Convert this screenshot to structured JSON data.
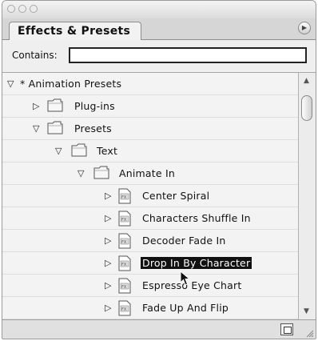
{
  "panel": {
    "tab_label": "Effects & Presets",
    "contains_label": "Contains:",
    "contains_value": ""
  },
  "tree": [
    {
      "label": "* Animation Presets",
      "type": "root",
      "expanded": true
    },
    {
      "label": "Plug-ins",
      "type": "folder",
      "expanded": false
    },
    {
      "label": "Presets",
      "type": "folder",
      "expanded": true
    },
    {
      "label": "Text",
      "type": "folder",
      "expanded": true
    },
    {
      "label": "Animate In",
      "type": "folder",
      "expanded": true
    },
    {
      "label": "Center Spiral",
      "type": "preset"
    },
    {
      "label": "Characters Shuffle In",
      "type": "preset"
    },
    {
      "label": "Decoder Fade In",
      "type": "preset"
    },
    {
      "label": "Drop In By Character",
      "type": "preset",
      "selected": true
    },
    {
      "label": "Espresso Eye Chart",
      "type": "preset"
    },
    {
      "label": "Fade Up And Flip",
      "type": "preset"
    }
  ],
  "colors": {
    "selection": "#111111",
    "panel_bg": "#e4e4e4"
  },
  "icons": {
    "menu": "flyout-menu-icon",
    "new": "new-item-icon",
    "folder": "folder-icon",
    "preset": "ffx-preset-icon"
  }
}
